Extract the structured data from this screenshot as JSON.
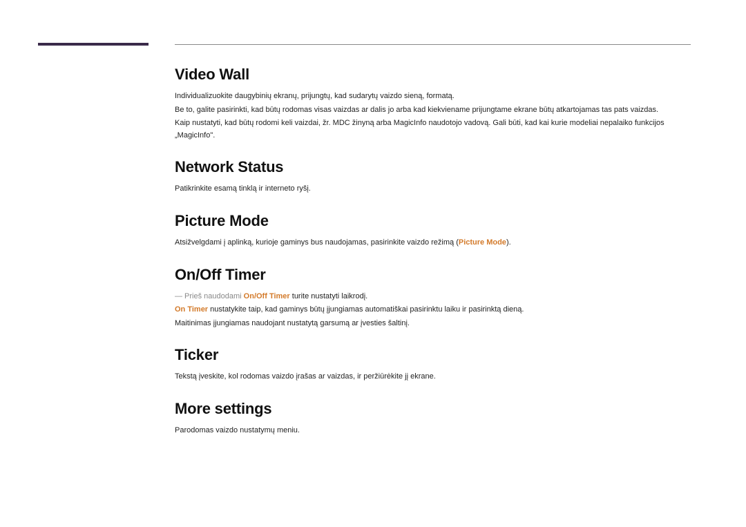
{
  "sections": {
    "video_wall": {
      "heading": "Video Wall",
      "p1": "Individualizuokite daugybinių ekranų, prijungtų, kad sudarytų vaizdo sieną, formatą.",
      "p2": "Be to, galite pasirinkti, kad būtų rodomas visas vaizdas ar dalis jo arba kad kiekviename prijungtame ekrane būtų atkartojamas tas pats vaizdas.",
      "p3": "Kaip nustatyti, kad būtų rodomi keli vaizdai, žr. MDC žinyną arba MagicInfo naudotojo vadovą. Gali būti, kad kai kurie modeliai nepalaiko funkcijos „MagicInfo\"."
    },
    "network_status": {
      "heading": "Network Status",
      "p1": "Patikrinkite esamą tinklą ir interneto ryšį."
    },
    "picture_mode": {
      "heading": "Picture Mode",
      "p1_pre": "Atsižvelgdami į aplinką, kurioje gaminys bus naudojamas, pasirinkite vaizdo režimą (",
      "p1_hl": "Picture Mode",
      "p1_post": ")."
    },
    "on_off_timer": {
      "heading": "On/Off Timer",
      "note_pre": "―  Prieš naudodami ",
      "note_hl": "On/Off Timer",
      "note_post": " turite nustatyti laikrodį.",
      "p2_hl": "On Timer",
      "p2_post": " nustatykite taip, kad gaminys būtų įjungiamas automatiškai pasirinktu laiku ir pasirinktą dieną.",
      "p3": "Maitinimas įjungiamas naudojant nustatytą garsumą ar įvesties šaltinį."
    },
    "ticker": {
      "heading": "Ticker",
      "p1": "Tekstą įveskite, kol rodomas vaizdo įrašas ar vaizdas, ir peržiūrėkite jį ekrane."
    },
    "more_settings": {
      "heading": "More settings",
      "p1": "Parodomas vaizdo nustatymų meniu."
    }
  }
}
